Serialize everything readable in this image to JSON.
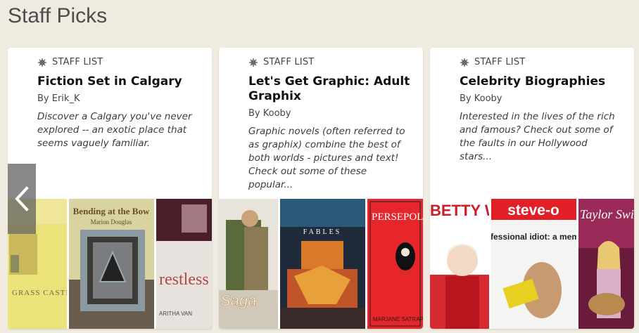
{
  "section": {
    "title": "Staff Picks"
  },
  "carousel": {
    "prev_icon": "chevron-left-icon",
    "cards": [
      {
        "type_label": "STAFF LIST",
        "title": "Fiction Set in Calgary",
        "author": "By Erik_K",
        "description": "Discover a Calgary you've never explored -- an exotic place that seems vaguely familiar.",
        "covers": [
          {
            "text": "GRASS CASTLES"
          },
          {
            "text": "Bending at the Bow",
            "author": "Marion Douglas"
          },
          {
            "text": "restless",
            "author": "ARITHA VAN"
          }
        ]
      },
      {
        "type_label": "STAFF LIST",
        "title": "Let's Get Graphic: Adult Graphix",
        "author": "By Kooby",
        "description": "Graphic novels (often referred to as graphix) combine the best of both worlds - pictures and text! Check out some of these popular...",
        "covers": [
          {
            "text": "Saga"
          },
          {
            "text": "FABLES"
          },
          {
            "text": "PERSEPOLIS",
            "author": "MARJANE SATRAPI"
          }
        ]
      },
      {
        "type_label": "STAFF LIST",
        "title": "Celebrity Biographies",
        "author": "By Kooby",
        "description": "Interested in the lives of the rich and famous? Check out some of the faults in our Hollywood stars...",
        "covers": [
          {
            "text": "BETTY WHITE"
          },
          {
            "text": "steve-o",
            "subtitle": "professional idiot: a memoir"
          },
          {
            "text": "Taylor Swift"
          }
        ]
      }
    ]
  }
}
